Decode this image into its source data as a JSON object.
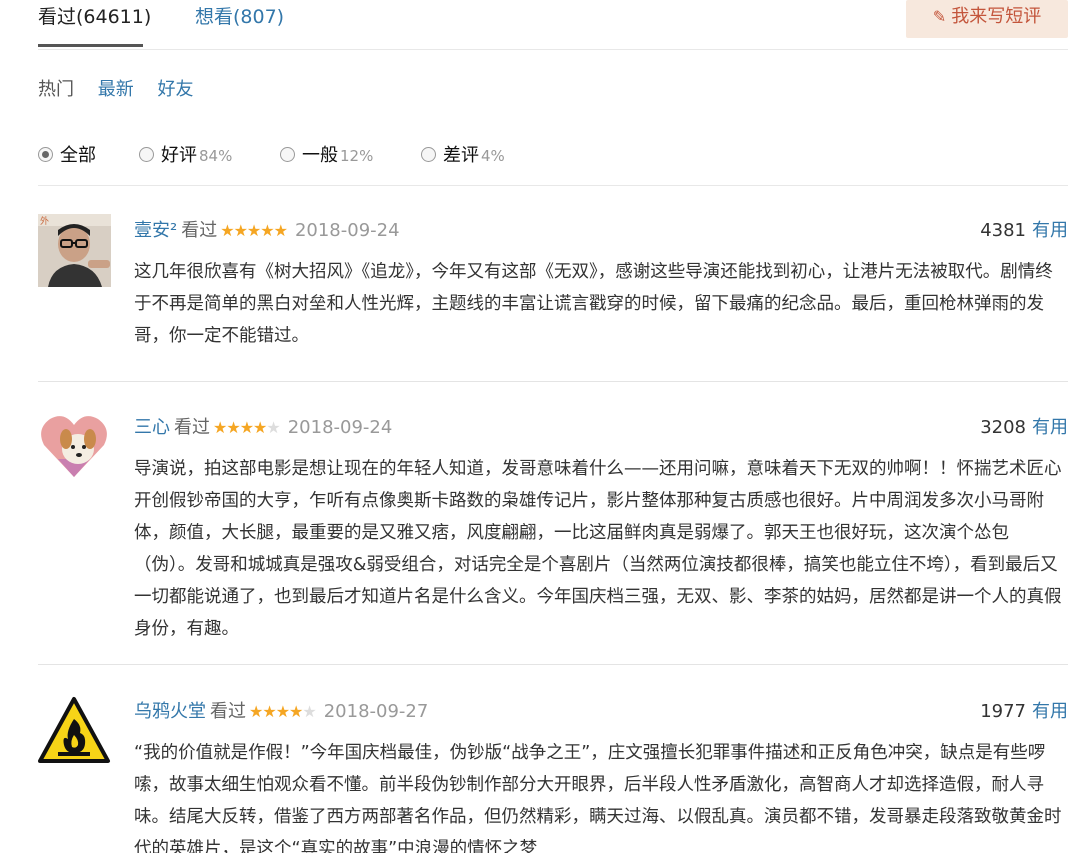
{
  "tabs": {
    "seen": "看过(64611)",
    "want": "想看(807)",
    "write_button": "我来写短评"
  },
  "sort": {
    "hot": "热门",
    "newest": "最新",
    "friends": "好友"
  },
  "filter": {
    "all": "全部",
    "good": "好评",
    "good_pct": "84%",
    "mid": "一般",
    "mid_pct": "12%",
    "bad": "差评",
    "bad_pct": "4%",
    "selected": "all"
  },
  "comments": [
    {
      "user": "壹安²",
      "status": "看过",
      "rating": 5,
      "date": "2018-09-24",
      "votes": "4381",
      "useful": "有用",
      "text": "这几年很欣喜有《树大招风》《追龙》，今年又有这部《无双》，感谢这些导演还能找到初心，让港片无法被取代。剧情终于不再是简单的黑白对垒和人性光辉，主题线的丰富让谎言戳穿的时候，留下最痛的纪念品。最后，重回枪林弹雨的发哥，你一定不能错过。"
    },
    {
      "user": "三心",
      "status": "看过",
      "rating": 4,
      "date": "2018-09-24",
      "votes": "3208",
      "useful": "有用",
      "text": "导演说，拍这部电影是想让现在的年轻人知道，发哥意味着什么——还用问嘛，意味着天下无双的帅啊！！怀揣艺术匠心开创假钞帝国的大亨，乍听有点像奥斯卡路数的枭雄传记片，影片整体那种复古质感也很好。片中周润发多次小马哥附体，颜值，大长腿，最重要的是又雅又痞，风度翩翩，一比这届鲜肉真是弱爆了。郭天王也很好玩，这次演个怂包（伪）。发哥和城城真是强攻&弱受组合，对话完全是个喜剧片（当然两位演技都很棒，搞笑也能立住不垮），看到最后又一切都能说通了，也到最后才知道片名是什么含义。今年国庆档三强，无双、影、李茶的姑妈，居然都是讲一个人的真假身份，有趣。"
    },
    {
      "user": "乌鸦火堂",
      "status": "看过",
      "rating": 4,
      "date": "2018-09-27",
      "votes": "1977",
      "useful": "有用",
      "text": "“我的价值就是作假！”今年国庆档最佳，伪钞版“战争之王”，庄文强擅长犯罪事件描述和正反角色冲突，缺点是有些啰嗦，故事太细生怕观众看不懂。前半段伪钞制作部分大开眼界，后半段人性矛盾激化，高智商人才却选择造假，耐人寻味。结尾大反转，借鉴了西方两部著名作品，但仍然精彩，瞒天过海、以假乱真。演员都不错，发哥暴走段落致敬黄金时代的英雄片，是这个“真实的故事”中浪漫的情怀之梦"
    }
  ],
  "colors": {
    "link": "#3377aa",
    "star": "#f5a623",
    "button_bg": "#f7e8dd",
    "button_text": "#c3553b"
  }
}
